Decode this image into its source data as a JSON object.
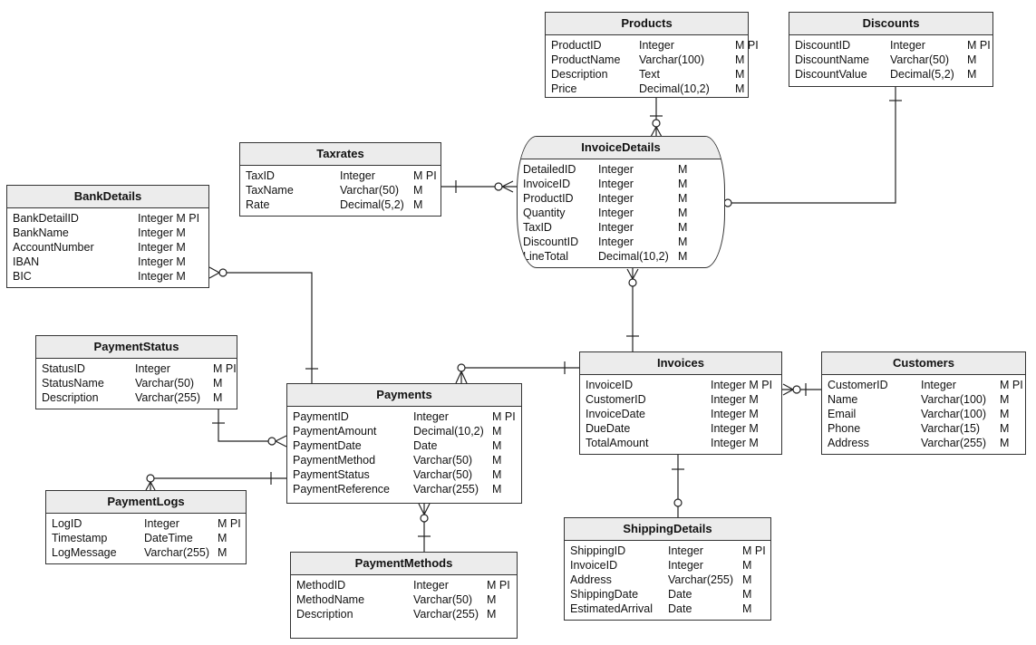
{
  "diagram": {
    "type": "entity-relationship",
    "notation": "crow's foot",
    "entities": {
      "products": {
        "name": "Products",
        "attributes": [
          {
            "name": "ProductID",
            "type": "Integer",
            "flags": "M PI"
          },
          {
            "name": "ProductName",
            "type": "Varchar(100)",
            "flags": "M"
          },
          {
            "name": "Description",
            "type": "Text",
            "flags": "M"
          },
          {
            "name": "Price",
            "type": "Decimal(10,2)",
            "flags": "M"
          }
        ]
      },
      "discounts": {
        "name": "Discounts",
        "attributes": [
          {
            "name": "DiscountID",
            "type": "Integer",
            "flags": "M PI"
          },
          {
            "name": "DiscountName",
            "type": "Varchar(50)",
            "flags": "M"
          },
          {
            "name": "DiscountValue",
            "type": "Decimal(5,2)",
            "flags": "M"
          }
        ]
      },
      "invoicedetails": {
        "name": "InvoiceDetails",
        "attributes": [
          {
            "name": "DetailedID",
            "type": "Integer",
            "flags": "M"
          },
          {
            "name": "InvoiceID",
            "type": "Integer",
            "flags": "M"
          },
          {
            "name": "ProductID",
            "type": "Integer",
            "flags": "M"
          },
          {
            "name": "Quantity",
            "type": "Integer",
            "flags": "M"
          },
          {
            "name": "TaxID",
            "type": "Integer",
            "flags": "M"
          },
          {
            "name": "DiscountID",
            "type": "Integer",
            "flags": "M"
          },
          {
            "name": "LineTotal",
            "type": "Decimal(10,2)",
            "flags": "M"
          }
        ]
      },
      "taxrates": {
        "name": "Taxrates",
        "attributes": [
          {
            "name": "TaxID",
            "type": "Integer",
            "flags": "M PI"
          },
          {
            "name": "TaxName",
            "type": "Varchar(50)",
            "flags": "M"
          },
          {
            "name": "Rate",
            "type": "Decimal(5,2)",
            "flags": "M"
          }
        ]
      },
      "bankdetails": {
        "name": "BankDetails",
        "attributes": [
          {
            "name": "BankDetailID",
            "type": "Integer",
            "flags": "M PI"
          },
          {
            "name": "BankName",
            "type": "Integer",
            "flags": "M"
          },
          {
            "name": "AccountNumber",
            "type": "Integer",
            "flags": "M"
          },
          {
            "name": "IBAN",
            "type": "Integer",
            "flags": "M"
          },
          {
            "name": "BIC",
            "type": "Integer",
            "flags": "M"
          }
        ]
      },
      "paymentstatus": {
        "name": "PaymentStatus",
        "attributes": [
          {
            "name": "StatusID",
            "type": "Integer",
            "flags": "M PI"
          },
          {
            "name": "StatusName",
            "type": "Varchar(50)",
            "flags": "M"
          },
          {
            "name": "Description",
            "type": "Varchar(255)",
            "flags": "M"
          }
        ]
      },
      "payments": {
        "name": "Payments",
        "attributes": [
          {
            "name": "PaymentID",
            "type": "Integer",
            "flags": "M PI"
          },
          {
            "name": "PaymentAmount",
            "type": "Decimal(10,2)",
            "flags": "M"
          },
          {
            "name": "PaymentDate",
            "type": "Date",
            "flags": "M"
          },
          {
            "name": "PaymentMethod",
            "type": "Varchar(50)",
            "flags": "M"
          },
          {
            "name": "PaymentStatus",
            "type": "Varchar(50)",
            "flags": "M"
          },
          {
            "name": "PaymentReference",
            "type": "Varchar(255)",
            "flags": "M"
          }
        ]
      },
      "paymentlogs": {
        "name": "PaymentLogs",
        "attributes": [
          {
            "name": "LogID",
            "type": "Integer",
            "flags": "M PI"
          },
          {
            "name": "Timestamp",
            "type": "DateTime",
            "flags": "M"
          },
          {
            "name": "LogMessage",
            "type": "Varchar(255)",
            "flags": "M"
          }
        ]
      },
      "paymentmethods": {
        "name": "PaymentMethods",
        "attributes": [
          {
            "name": "MethodID",
            "type": "Integer",
            "flags": "M PI"
          },
          {
            "name": "MethodName",
            "type": "Varchar(50)",
            "flags": "M"
          },
          {
            "name": "Description",
            "type": "Varchar(255)",
            "flags": "M"
          }
        ]
      },
      "invoices": {
        "name": "Invoices",
        "attributes": [
          {
            "name": "InvoiceID",
            "type": "Integer",
            "flags": "M PI"
          },
          {
            "name": "CustomerID",
            "type": "Integer",
            "flags": "M"
          },
          {
            "name": "InvoiceDate",
            "type": "Integer",
            "flags": "M"
          },
          {
            "name": "DueDate",
            "type": "Integer",
            "flags": "M"
          },
          {
            "name": "TotalAmount",
            "type": "Integer",
            "flags": "M"
          }
        ]
      },
      "customers": {
        "name": "Customers",
        "attributes": [
          {
            "name": "CustomerID",
            "type": "Integer",
            "flags": "M PI"
          },
          {
            "name": "Name",
            "type": "Varchar(100)",
            "flags": "M"
          },
          {
            "name": "Email",
            "type": "Varchar(100)",
            "flags": "M"
          },
          {
            "name": "Phone",
            "type": "Varchar(15)",
            "flags": "M"
          },
          {
            "name": "Address",
            "type": "Varchar(255)",
            "flags": "M"
          }
        ]
      },
      "shippingdetails": {
        "name": "ShippingDetails",
        "attributes": [
          {
            "name": "ShippingID",
            "type": "Integer",
            "flags": "M PI"
          },
          {
            "name": "InvoiceID",
            "type": "Integer",
            "flags": "M"
          },
          {
            "name": "Address",
            "type": "Varchar(255)",
            "flags": "M"
          },
          {
            "name": "ShippingDate",
            "type": "Date",
            "flags": "M"
          },
          {
            "name": "EstimatedArrival",
            "type": "Date",
            "flags": "M"
          }
        ]
      }
    },
    "relationships": [
      {
        "from": "Products",
        "to": "InvoiceDetails",
        "from_card": "one",
        "to_card": "zero-or-many"
      },
      {
        "from": "Discounts",
        "to": "InvoiceDetails",
        "from_card": "one",
        "to_card": "zero-or-many"
      },
      {
        "from": "Taxrates",
        "to": "InvoiceDetails",
        "from_card": "one",
        "to_card": "zero-or-many"
      },
      {
        "from": "Invoices",
        "to": "InvoiceDetails",
        "from_card": "one",
        "to_card": "zero-or-many"
      },
      {
        "from": "Invoices",
        "to": "Payments",
        "from_card": "one",
        "to_card": "zero-or-many"
      },
      {
        "from": "Customers",
        "to": "Invoices",
        "from_card": "one",
        "to_card": "zero-or-many"
      },
      {
        "from": "Invoices",
        "to": "ShippingDetails",
        "from_card": "one",
        "to_card": "zero-or-one"
      },
      {
        "from": "Payments",
        "to": "BankDetails",
        "from_card": "one",
        "to_card": "zero-or-many"
      },
      {
        "from": "PaymentStatus",
        "to": "Payments",
        "from_card": "one",
        "to_card": "zero-or-many"
      },
      {
        "from": "Payments",
        "to": "PaymentLogs",
        "from_card": "one",
        "to_card": "zero-or-many"
      },
      {
        "from": "PaymentMethods",
        "to": "Payments",
        "from_card": "one",
        "to_card": "zero-or-many"
      }
    ]
  }
}
